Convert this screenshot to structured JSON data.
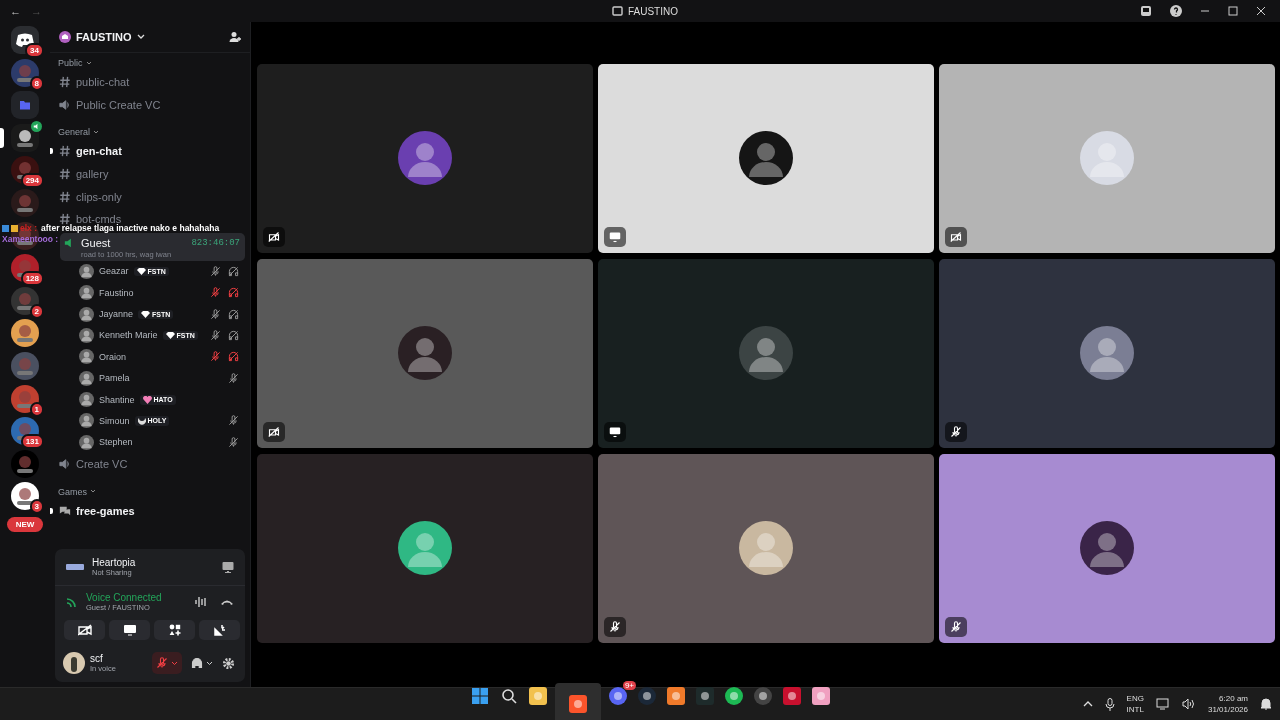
{
  "window": {
    "title": "FAUSTINO",
    "back": "←",
    "forward": "→"
  },
  "servers": [
    {
      "kind": "home",
      "badge": "34",
      "selected": false
    },
    {
      "kind": "server",
      "badge": "8",
      "selected": false
    },
    {
      "kind": "folder",
      "selected": false
    },
    {
      "kind": "server",
      "selected": true,
      "voice": true
    },
    {
      "kind": "server",
      "badge": "294",
      "selected": false
    },
    {
      "kind": "server",
      "selected": false
    },
    {
      "kind": "server",
      "selected": false
    },
    {
      "kind": "server",
      "badge": "128",
      "selected": false
    },
    {
      "kind": "server",
      "badge": "2",
      "selected": false
    },
    {
      "kind": "server",
      "selected": false
    },
    {
      "kind": "server",
      "selected": false
    },
    {
      "kind": "server",
      "badge": "1",
      "selected": false
    },
    {
      "kind": "server",
      "badge": "131",
      "selected": false
    },
    {
      "kind": "server",
      "selected": false
    },
    {
      "kind": "server",
      "badge": "3",
      "selected": false
    }
  ],
  "new_pill": "NEW",
  "server_name": "FAUSTINO",
  "categories": [
    {
      "name": "Public",
      "channels": [
        {
          "kind": "text",
          "name": "public-chat",
          "unread": false
        },
        {
          "kind": "voice",
          "name": "Public Create VC",
          "unread": false
        }
      ]
    },
    {
      "name": "General",
      "channels": [
        {
          "kind": "text",
          "name": "gen-chat",
          "unread": true
        },
        {
          "kind": "text",
          "name": "gallery",
          "unread": false
        },
        {
          "kind": "text",
          "name": "clips-only",
          "unread": false
        },
        {
          "kind": "text",
          "name": "bot-cmds",
          "unread": false
        },
        {
          "kind": "voice",
          "name": "Guest",
          "selected": true,
          "timer": "823:46:07",
          "status": "road to 1000 hrs, wag iwan",
          "members": [
            {
              "name": "Geazar",
              "tag": {
                "kind": "gem",
                "text": "FSTN"
              },
              "muted": true,
              "deafened": true,
              "server_muted": false
            },
            {
              "name": "Faustino",
              "muted": true,
              "deafened": true,
              "server_muted": true
            },
            {
              "name": "Jayanne",
              "tag": {
                "kind": "gem",
                "text": "FSTN"
              },
              "muted": true,
              "deafened": true,
              "server_muted": false
            },
            {
              "name": "Kenneth Marie",
              "tag": {
                "kind": "gem",
                "text": "FSTN"
              },
              "muted": true,
              "deafened": true,
              "server_muted": false
            },
            {
              "name": "Oraion",
              "muted": true,
              "deafened": true,
              "server_muted": true
            },
            {
              "name": "Pamela",
              "muted": true,
              "deafened": false,
              "server_muted": false
            },
            {
              "name": "Shantine",
              "tag": {
                "kind": "heart",
                "text": "HATO"
              },
              "muted": false,
              "deafened": false
            },
            {
              "name": "Simoun",
              "tag": {
                "kind": "moon",
                "text": "HOLY"
              },
              "muted": true,
              "deafened": false,
              "server_muted": false
            },
            {
              "name": "Stephen",
              "muted": true,
              "deafened": false,
              "server_muted": false
            }
          ]
        },
        {
          "kind": "voice",
          "name": "Create VC",
          "unread": false
        }
      ]
    },
    {
      "name": "Games",
      "channels": [
        {
          "kind": "forum",
          "name": "free-games",
          "unread": true
        }
      ]
    }
  ],
  "overlay_chat": [
    {
      "author": "elx :",
      "message": "after relapse tlaga inactive nako e hahahaha"
    },
    {
      "author": "Xameentooo :"
    }
  ],
  "activity": {
    "title": "Heartopia",
    "subtitle": "Not Sharing"
  },
  "voice": {
    "title": "Voice Connected",
    "subtitle": "Guest / FAUSTINO"
  },
  "user": {
    "name": "scf",
    "status": "In voice",
    "mic_muted": true
  },
  "tiles": [
    {
      "color": "#1e1e1e",
      "camera_off": true
    },
    {
      "color": "#dcdcdc",
      "streaming": true
    },
    {
      "color": "#b4b4b4",
      "camera_off": true
    },
    {
      "color": "#595959",
      "camera_off": true
    },
    {
      "color": "#182020",
      "streaming": true
    },
    {
      "color": "#2e323f",
      "muted": true
    },
    {
      "color": "#272123"
    },
    {
      "color": "#5f5557",
      "muted": true
    },
    {
      "color": "#a78bd1",
      "muted": true
    }
  ],
  "taskbar": {
    "apps": [
      {
        "kind": "start"
      },
      {
        "kind": "search"
      },
      {
        "kind": "files"
      },
      {
        "kind": "browser",
        "active": true
      },
      {
        "kind": "chat",
        "badge": "9+"
      },
      {
        "kind": "steam"
      },
      {
        "kind": "orange"
      },
      {
        "kind": "terminal"
      },
      {
        "kind": "music"
      },
      {
        "kind": "record"
      },
      {
        "kind": "x"
      },
      {
        "kind": "game"
      }
    ],
    "lang": "ENG",
    "layout": "INTL",
    "time": "6:20 am",
    "date": "31/01/2026"
  }
}
